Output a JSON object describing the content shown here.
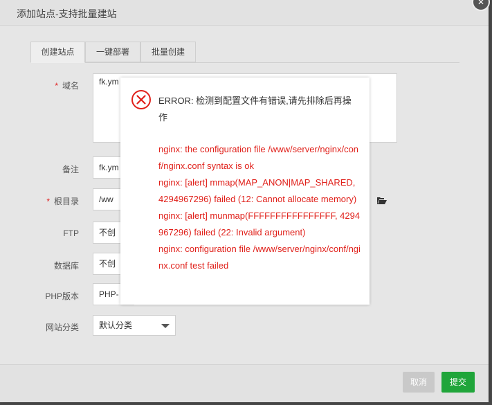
{
  "dialog": {
    "title": "添加站点-支持批量建站",
    "close_glyph": "✕"
  },
  "tabs": [
    {
      "label": "创建站点",
      "active": true
    },
    {
      "label": "一键部署",
      "active": false
    },
    {
      "label": "批量创建",
      "active": false
    }
  ],
  "form": {
    "domain": {
      "label": "域名",
      "required": true,
      "value": "fk.ym"
    },
    "note": {
      "label": "备注",
      "value": "fk.ym"
    },
    "root": {
      "label": "根目录",
      "required": true,
      "value": "/ww"
    },
    "ftp": {
      "label": "FTP",
      "value": "不创"
    },
    "database": {
      "label": "数据库",
      "value": "不创"
    },
    "php": {
      "label": "PHP版本",
      "value": "PHP-"
    },
    "category": {
      "label": "网站分类",
      "value": "默认分类"
    }
  },
  "footer": {
    "cancel_label": "取消",
    "submit_label": "提交"
  },
  "error_popup": {
    "title": "ERROR: 检测到配置文件有错误,请先排除后再操作",
    "lines": [
      "nginx: the configuration file /www/server/nginx/conf/nginx.conf syntax is ok",
      "nginx: [alert] mmap(MAP_ANON|MAP_SHARED, 4294967296) failed (12: Cannot allocate memory)",
      "nginx: [alert] munmap(FFFFFFFFFFFFFFFF, 4294967296) failed (22: Invalid argument)",
      "nginx: configuration file /www/server/nginx/conf/nginx.conf test failed"
    ]
  },
  "colors": {
    "error_red": "#e0201a",
    "submit_green": "#20a53a",
    "cancel_gray": "#c9c9c9"
  },
  "icons": {
    "error": "error-x-circle-icon",
    "folder": "folder-open-icon",
    "close": "close-icon",
    "dropdown": "chevron-down-icon"
  }
}
